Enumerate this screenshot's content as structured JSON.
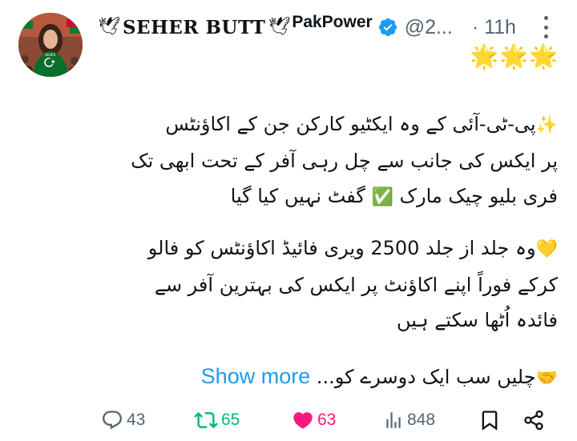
{
  "tweet": {
    "author": {
      "dove_left": "🕊",
      "display_name": "SEHER BUTT",
      "dove_right": "🕊",
      "display_name_2": "PakPower",
      "handle": "@2...",
      "time": "· 11h",
      "verified": true,
      "stars": "🌟🌟🌟",
      "avatar_text": "SEHER"
    },
    "body": {
      "para1_emoji": "✨",
      "para1_line1": "پی-ٹی-آئی کے وہ ایکٹیو کارکن جن کے اکاؤنٹس",
      "para1_line2": "پر ایکس کی جانب سے چل رہی آفر کے تحت ابھی تک",
      "para1_line3a": "فری بلیو چیک مارک",
      "para1_check": "✅",
      "para1_line3b": "گفٹ نہیں کیا گیا",
      "para2_emoji": "💛",
      "para2_line1": "وہ جلد از جلد 2500 ویری فائیڈ اکاؤنٹس کو فالو",
      "para2_line2": "کرکے فوراً اپنے اکاؤنٹ پر ایکس کی بہترین آفر سے",
      "para2_line3": "فائدہ اُٹھا سکتے ہیں",
      "para3_emoji": "🤝",
      "para3_text": "چلیں سب ایک دوسرے کو...",
      "show_more": "Show more"
    },
    "actions": {
      "replies": "43",
      "retweets": "65",
      "likes": "63",
      "views": "848"
    }
  },
  "colors": {
    "accent": "#1d9bf0",
    "secondary_text": "#536471",
    "retweet": "#00ba7c",
    "like": "#f91880"
  }
}
